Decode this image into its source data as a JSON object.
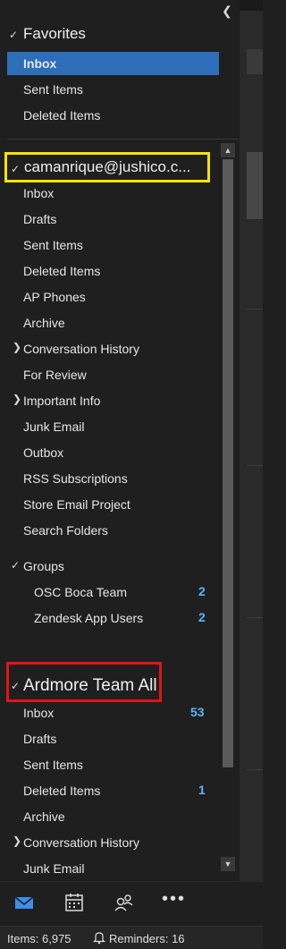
{
  "favorites": {
    "header": "Favorites",
    "items": [
      "Inbox",
      "Sent Items",
      "Deleted Items"
    ]
  },
  "account1": {
    "header": "camanrique@jushico.c...",
    "items": [
      "Inbox",
      "Drafts",
      "Sent Items",
      "Deleted Items",
      "AP Phones",
      "Archive",
      "Conversation History",
      "For Review",
      "Important Info",
      "Junk Email",
      "Outbox",
      "RSS Subscriptions",
      "Store Email Project",
      "Search Folders"
    ]
  },
  "groups": {
    "header": "Groups",
    "items": [
      {
        "label": "OSC Boca Team",
        "count": "2"
      },
      {
        "label": "Zendesk App Users",
        "count": "2"
      }
    ]
  },
  "account2": {
    "header": "Ardmore Team All",
    "items": [
      "Inbox",
      "Drafts",
      "Sent Items",
      "Deleted Items",
      "Archive",
      "Conversation History",
      "Junk Email"
    ],
    "inbox_count": "53",
    "deleted_count": "1"
  },
  "status": {
    "items": "Items: 6,975",
    "reminders": "Reminders: 16"
  },
  "icons": [
    "collapse-chevron-icon",
    "mail-icon",
    "calendar-icon",
    "people-icon",
    "more-icon",
    "bell-icon"
  ],
  "colors": {
    "accent": "#2e6eb8",
    "badge": "#5fb3ff",
    "highlight_yellow": "#f2e600",
    "highlight_red": "#e01515"
  }
}
